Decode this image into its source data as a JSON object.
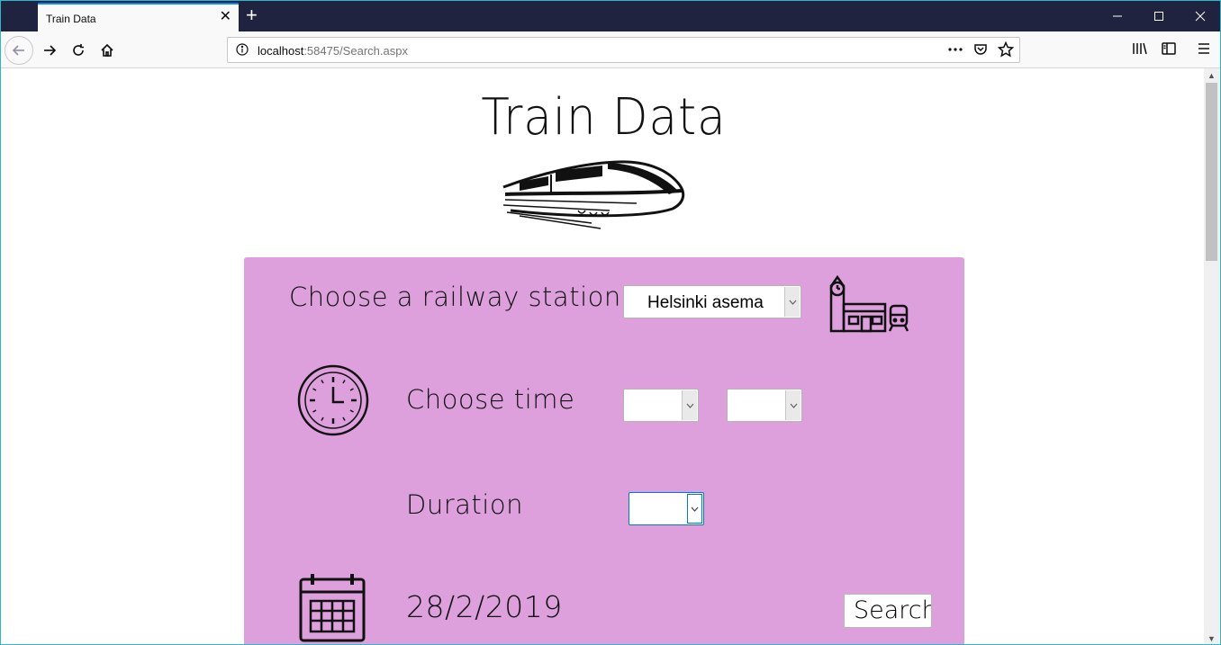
{
  "browser": {
    "tab_title": "Train Data",
    "url_host": "localhost",
    "url_rest": ":58475/Search.aspx"
  },
  "page": {
    "title": "Train Data",
    "station_label": "Choose a railway station",
    "station_value": "Helsinki asema",
    "time_label": "Choose time",
    "hour_value": "",
    "minute_value": "",
    "duration_label": "Duration",
    "duration_value": "",
    "date": "28/2/2019",
    "search_label": "Search"
  },
  "colors": {
    "panel": "#dda0dd",
    "titlebar": "#202340"
  },
  "icons": [
    "back-arrow-icon",
    "forward-arrow-icon",
    "reload-icon",
    "home-icon",
    "info-icon",
    "more-icon",
    "pocket-icon",
    "star-icon",
    "library-icon",
    "sidebar-icon",
    "menu-icon",
    "train-icon",
    "station-icon",
    "clock-icon",
    "calendar-icon"
  ]
}
